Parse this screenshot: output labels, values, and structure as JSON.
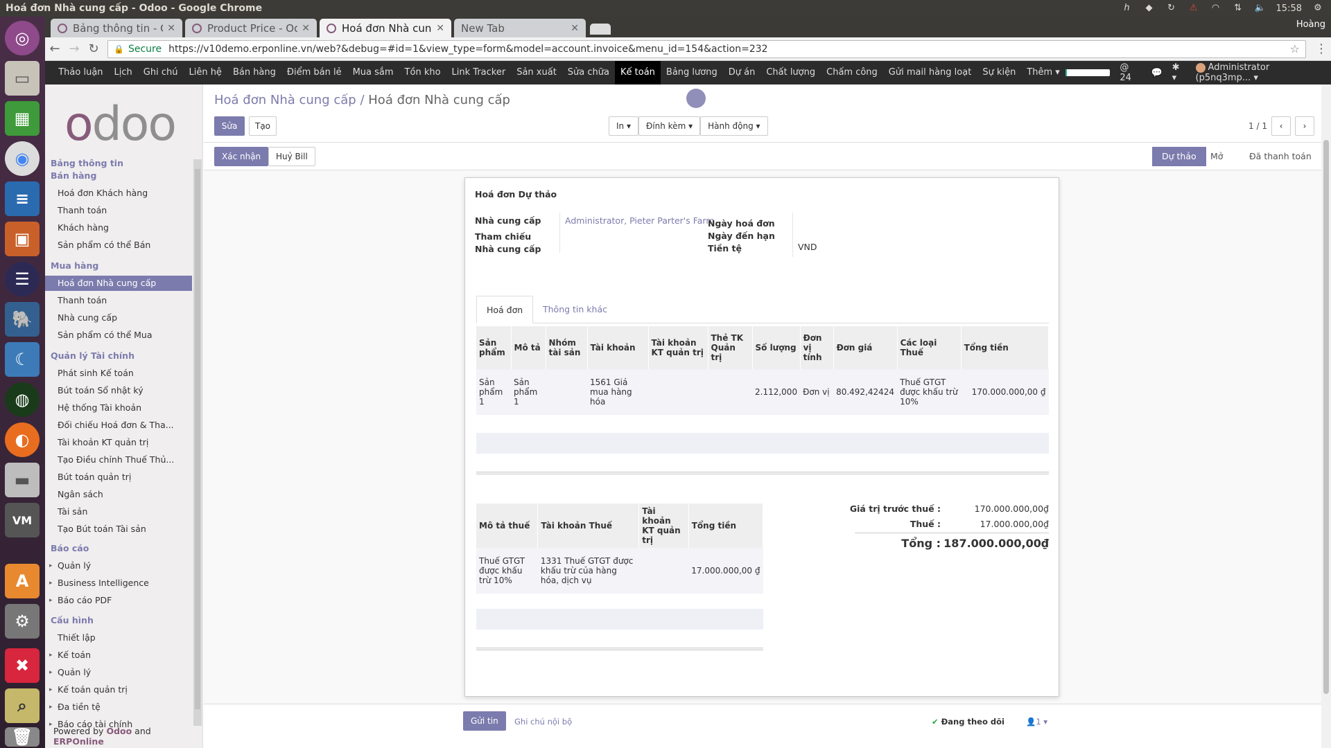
{
  "os": {
    "window_title": "Hoá đơn Nhà cung cấp - Odoo - Google Chrome",
    "time": "15:58",
    "user": "Hoàng"
  },
  "chrome": {
    "tabs": [
      {
        "title": "Bảng thông tin - O"
      },
      {
        "title": "Product Price - Odo"
      },
      {
        "title": "Hoá đơn Nhà cun"
      },
      {
        "title": "New Tab"
      }
    ],
    "secure_label": "Secure",
    "url": "https://v10demo.erponline.vn/web?&debug=#id=1&view_type=form&model=account.invoice&menu_id=154&action=232"
  },
  "menu": {
    "items": [
      "Thảo luận",
      "Lịch",
      "Ghi chú",
      "Liên hệ",
      "Bán hàng",
      "Điểm bán lẻ",
      "Mua sắm",
      "Tồn kho",
      "Link Tracker",
      "Sản xuất",
      "Sửa chữa",
      "Kế toán",
      "Bảng lương",
      "Dự án",
      "Chất lượng",
      "Chấm công",
      "Gửi mail hàng loạt",
      "Sự kiện",
      "Thêm"
    ],
    "messages_count": "24",
    "user": "Administrator (p5nq3mp...",
    "progress": 0.04
  },
  "sidebar": {
    "logo": "odoo",
    "sections": {
      "dashboard": "Bảng thông tin",
      "sales": "Bán hàng",
      "purchase": "Mua hàng",
      "finance": "Quản lý Tài chính",
      "reports": "Báo cáo",
      "config": "Cấu hình"
    },
    "sales_items": [
      "Hoá đơn Khách hàng",
      "Thanh toán",
      "Khách hàng",
      "Sản phẩm có thể Bán"
    ],
    "purchase_items": [
      "Hoá đơn Nhà cung cấp",
      "Thanh toán",
      "Nhà cung cấp",
      "Sản phẩm có thể Mua"
    ],
    "finance_items": [
      "Phát sinh Kế toán",
      "Bút toán Sổ nhật ký",
      "Hệ thống Tài khoản",
      "Đối chiếu Hoá đơn & Tha...",
      "Tài khoản KT quản trị",
      "Tạo Điều chỉnh Thuế Thủ...",
      "Bút toán quản trị",
      "Ngân sách",
      "Tài sản",
      "Tạo Bút toán Tài sản"
    ],
    "report_items": [
      "Quản lý",
      "Business Intelligence",
      "Báo cáo PDF"
    ],
    "config_items": [
      "Thiết lập",
      "Kế toán",
      "Quản lý",
      "Kế toán quản trị",
      "Đa tiền tệ",
      "Báo cáo tài chính"
    ],
    "powered_prefix": "Powered by",
    "powered_odoo": "Odoo",
    "powered_and": "and",
    "powered_erp": "ERPOnline"
  },
  "control": {
    "breadcrumb_parent": "Hoá đơn Nhà cung cấp",
    "breadcrumb_sep": "/",
    "breadcrumb_current": "Hoá đơn Nhà cung cấp",
    "edit": "Sửa",
    "create": "Tạo",
    "print": "In",
    "attach": "Đính kèm",
    "action": "Hành động",
    "pager": "1 / 1"
  },
  "status": {
    "confirm": "Xác nhận",
    "cancel_bill": "Huỷ Bill",
    "stages": [
      "Dự thảo",
      "Mở",
      "Đã thanh toán"
    ]
  },
  "form": {
    "title": "Hoá đơn Dự thảo",
    "vendor_label": "Nhà cung cấp",
    "vendor_value": "Administrator, Pieter Parter's Farm",
    "vendor_ref_label": "Tham chiếu Nhà cung cấp",
    "invoice_date_label": "Ngày hoá đơn",
    "due_date_label": "Ngày đến hạn",
    "currency_label": "Tiền tệ",
    "currency_value": "VND",
    "tabs": [
      "Hoá đơn",
      "Thông tin khác"
    ],
    "lines": {
      "headers": [
        "Sản phẩm",
        "Mô tả",
        "Nhóm tài sản",
        "Tài khoản",
        "Tài khoản KT quản trị",
        "Thẻ TK Quản trị",
        "Số lượng",
        "Đơn vị tính",
        "Đơn giá",
        "Các loại Thuế",
        "Tổng tiền"
      ],
      "rows": [
        [
          "Sản phẩm 1",
          "Sản phẩm 1",
          "",
          "1561 Giá mua hàng hóa",
          "",
          "",
          "2.112,000",
          "Đơn vị",
          "80.492,42424",
          "Thuế GTGT được khấu trừ 10%",
          "170.000.000,00 ₫"
        ]
      ]
    },
    "taxes": {
      "headers": [
        "Mô tả thuế",
        "Tài khoản Thuế",
        "Tài khoản KT quản trị",
        "Tổng tiền"
      ],
      "rows": [
        [
          "Thuế GTGT được khấu trừ 10%",
          "1331 Thuế GTGT được khấu trừ của hàng hóa, dịch vụ",
          "",
          "17.000.000,00 ₫"
        ]
      ]
    },
    "totals": {
      "untaxed_label": "Giá trị trước thuế :",
      "untaxed_value": "170.000.000,00₫",
      "tax_label": "Thuế :",
      "tax_value": "17.000.000,00₫",
      "total_label": "Tổng :",
      "total_value": "187.000.000,00₫"
    }
  },
  "chatter": {
    "send": "Gửi tin",
    "log_note": "Ghi chú nội bộ",
    "following": "Đang theo dõi",
    "followers": "1"
  }
}
